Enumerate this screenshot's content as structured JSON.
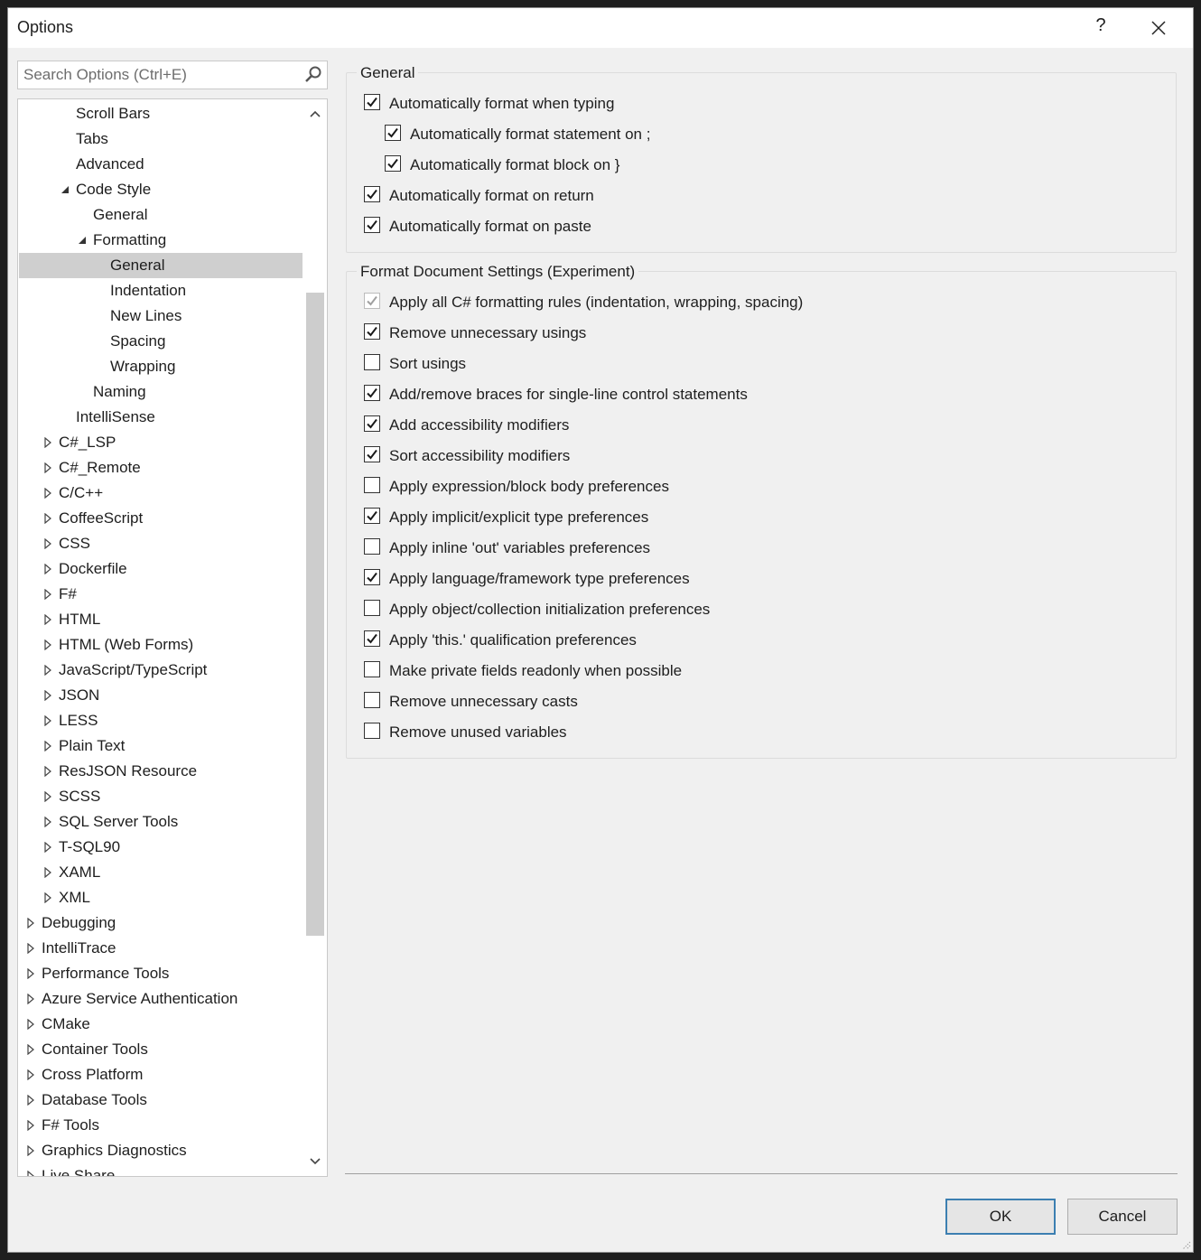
{
  "window": {
    "title": "Options",
    "help_label": "?"
  },
  "search": {
    "placeholder": "Search Options (Ctrl+E)"
  },
  "tree": {
    "items": [
      {
        "label": "Scroll Bars",
        "indent": 3,
        "expander": "none",
        "selected": false
      },
      {
        "label": "Tabs",
        "indent": 3,
        "expander": "none",
        "selected": false
      },
      {
        "label": "Advanced",
        "indent": 3,
        "expander": "none",
        "selected": false
      },
      {
        "label": "Code Style",
        "indent": 3,
        "expander": "expanded",
        "selected": false
      },
      {
        "label": "General",
        "indent": 4,
        "expander": "none",
        "selected": false
      },
      {
        "label": "Formatting",
        "indent": 4,
        "expander": "expanded",
        "selected": false
      },
      {
        "label": "General",
        "indent": 5,
        "expander": "none",
        "selected": true
      },
      {
        "label": "Indentation",
        "indent": 5,
        "expander": "none",
        "selected": false
      },
      {
        "label": "New Lines",
        "indent": 5,
        "expander": "none",
        "selected": false
      },
      {
        "label": "Spacing",
        "indent": 5,
        "expander": "none",
        "selected": false
      },
      {
        "label": "Wrapping",
        "indent": 5,
        "expander": "none",
        "selected": false
      },
      {
        "label": "Naming",
        "indent": 4,
        "expander": "none",
        "selected": false
      },
      {
        "label": "IntelliSense",
        "indent": 3,
        "expander": "none",
        "selected": false
      },
      {
        "label": "C#_LSP",
        "indent": 2,
        "expander": "collapsed",
        "selected": false
      },
      {
        "label": "C#_Remote",
        "indent": 2,
        "expander": "collapsed",
        "selected": false
      },
      {
        "label": "C/C++",
        "indent": 2,
        "expander": "collapsed",
        "selected": false
      },
      {
        "label": "CoffeeScript",
        "indent": 2,
        "expander": "collapsed",
        "selected": false
      },
      {
        "label": "CSS",
        "indent": 2,
        "expander": "collapsed",
        "selected": false
      },
      {
        "label": "Dockerfile",
        "indent": 2,
        "expander": "collapsed",
        "selected": false
      },
      {
        "label": "F#",
        "indent": 2,
        "expander": "collapsed",
        "selected": false
      },
      {
        "label": "HTML",
        "indent": 2,
        "expander": "collapsed",
        "selected": false
      },
      {
        "label": "HTML (Web Forms)",
        "indent": 2,
        "expander": "collapsed",
        "selected": false
      },
      {
        "label": "JavaScript/TypeScript",
        "indent": 2,
        "expander": "collapsed",
        "selected": false
      },
      {
        "label": "JSON",
        "indent": 2,
        "expander": "collapsed",
        "selected": false
      },
      {
        "label": "LESS",
        "indent": 2,
        "expander": "collapsed",
        "selected": false
      },
      {
        "label": "Plain Text",
        "indent": 2,
        "expander": "collapsed",
        "selected": false
      },
      {
        "label": "ResJSON Resource",
        "indent": 2,
        "expander": "collapsed",
        "selected": false
      },
      {
        "label": "SCSS",
        "indent": 2,
        "expander": "collapsed",
        "selected": false
      },
      {
        "label": "SQL Server Tools",
        "indent": 2,
        "expander": "collapsed",
        "selected": false
      },
      {
        "label": "T-SQL90",
        "indent": 2,
        "expander": "collapsed",
        "selected": false
      },
      {
        "label": "XAML",
        "indent": 2,
        "expander": "collapsed",
        "selected": false
      },
      {
        "label": "XML",
        "indent": 2,
        "expander": "collapsed",
        "selected": false
      },
      {
        "label": "Debugging",
        "indent": 1,
        "expander": "collapsed",
        "selected": false
      },
      {
        "label": "IntelliTrace",
        "indent": 1,
        "expander": "collapsed",
        "selected": false
      },
      {
        "label": "Performance Tools",
        "indent": 1,
        "expander": "collapsed",
        "selected": false
      },
      {
        "label": "Azure Service Authentication",
        "indent": 1,
        "expander": "collapsed",
        "selected": false
      },
      {
        "label": "CMake",
        "indent": 1,
        "expander": "collapsed",
        "selected": false
      },
      {
        "label": "Container Tools",
        "indent": 1,
        "expander": "collapsed",
        "selected": false
      },
      {
        "label": "Cross Platform",
        "indent": 1,
        "expander": "collapsed",
        "selected": false
      },
      {
        "label": "Database Tools",
        "indent": 1,
        "expander": "collapsed",
        "selected": false
      },
      {
        "label": "F# Tools",
        "indent": 1,
        "expander": "collapsed",
        "selected": false
      },
      {
        "label": "Graphics Diagnostics",
        "indent": 1,
        "expander": "collapsed",
        "selected": false
      },
      {
        "label": "Live Share",
        "indent": 1,
        "expander": "collapsed",
        "selected": false
      }
    ]
  },
  "general_group": {
    "title": "General",
    "options": [
      {
        "label": "Automatically format when typing",
        "checked": true,
        "disabled": false,
        "level": 0
      },
      {
        "label": "Automatically format statement on ;",
        "checked": true,
        "disabled": false,
        "level": 1
      },
      {
        "label": "Automatically format block on }",
        "checked": true,
        "disabled": false,
        "level": 1
      },
      {
        "label": "Automatically format on return",
        "checked": true,
        "disabled": false,
        "level": 0
      },
      {
        "label": "Automatically format on paste",
        "checked": true,
        "disabled": false,
        "level": 0
      }
    ]
  },
  "format_document_group": {
    "title": "Format Document Settings (Experiment)",
    "options": [
      {
        "label": "Apply all C# formatting rules (indentation, wrapping, spacing)",
        "checked": true,
        "disabled": true,
        "level": 0
      },
      {
        "label": "Remove unnecessary usings",
        "checked": true,
        "disabled": false,
        "level": 0
      },
      {
        "label": "Sort usings",
        "checked": false,
        "disabled": false,
        "level": 0
      },
      {
        "label": "Add/remove braces for single-line control statements",
        "checked": true,
        "disabled": false,
        "level": 0
      },
      {
        "label": "Add accessibility modifiers",
        "checked": true,
        "disabled": false,
        "level": 0
      },
      {
        "label": "Sort accessibility modifiers",
        "checked": true,
        "disabled": false,
        "level": 0
      },
      {
        "label": "Apply expression/block body preferences",
        "checked": false,
        "disabled": false,
        "level": 0
      },
      {
        "label": "Apply implicit/explicit type preferences",
        "checked": true,
        "disabled": false,
        "level": 0
      },
      {
        "label": "Apply inline 'out' variables preferences",
        "checked": false,
        "disabled": false,
        "level": 0
      },
      {
        "label": "Apply language/framework type preferences",
        "checked": true,
        "disabled": false,
        "level": 0
      },
      {
        "label": "Apply object/collection initialization preferences",
        "checked": false,
        "disabled": false,
        "level": 0
      },
      {
        "label": "Apply 'this.' qualification preferences",
        "checked": true,
        "disabled": false,
        "level": 0
      },
      {
        "label": "Make private fields readonly when possible",
        "checked": false,
        "disabled": false,
        "level": 0
      },
      {
        "label": "Remove unnecessary casts",
        "checked": false,
        "disabled": false,
        "level": 0
      },
      {
        "label": "Remove unused variables",
        "checked": false,
        "disabled": false,
        "level": 0
      }
    ]
  },
  "buttons": {
    "ok_label": "OK",
    "cancel_label": "Cancel"
  },
  "colors": {
    "selection": "#cfcfcf",
    "default_button_border": "#3c7fb1",
    "dialog_background": "#f0f0f0"
  }
}
